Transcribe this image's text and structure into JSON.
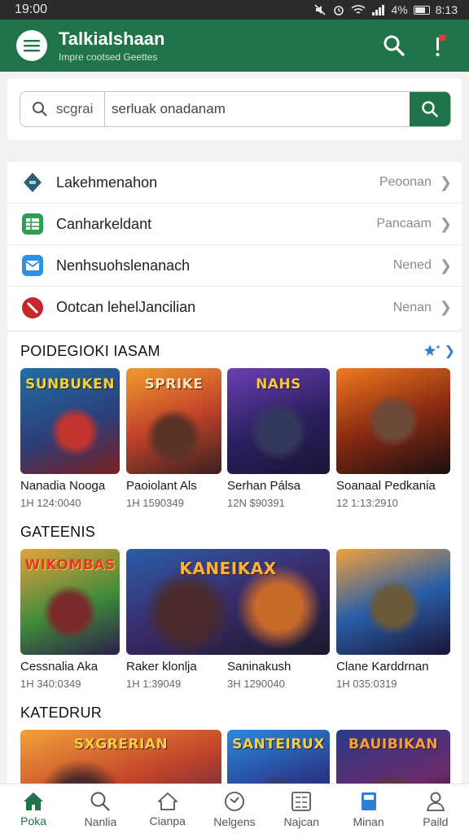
{
  "status_bar": {
    "time": "19:00",
    "battery_text": "4%",
    "clock_right": "8:13"
  },
  "app_bar": {
    "title": "Talkialshaan",
    "subtitle": "Impre cootsed Geettes"
  },
  "search": {
    "scope_label": "scgrai",
    "query": "serluak onadanam"
  },
  "list_items": [
    {
      "label": "Lakehmenahon",
      "value": "Peoonan",
      "icon": "tag-icon",
      "color": "#2f5d6e"
    },
    {
      "label": "Canharkeldant",
      "value": "Pancaam",
      "icon": "spreadsheet-icon",
      "color": "#2e9e55"
    },
    {
      "label": "Nenhsuohslenanach",
      "value": "Nened",
      "icon": "mail-icon",
      "color": "#2f8fe0"
    },
    {
      "label": "Ootcan lehelJancilian",
      "value": "Nenan",
      "icon": "slash-icon",
      "color": "#c8262b"
    }
  ],
  "sections": [
    {
      "title": "POIDEGIOKI IASAM",
      "more_icon": "sparkle-icon",
      "games": [
        {
          "art_title": "SUNBUKEN",
          "name": "Nanadia Nooga",
          "meta": "1H 124:0040"
        },
        {
          "art_title": "SPRIKE",
          "name": "Paoiolant Als",
          "meta": "1H 1590349"
        },
        {
          "art_title": "NAHS",
          "name": "Serhan Pálsa",
          "meta": "12N $90391"
        },
        {
          "art_title": "",
          "name": "Soanaal Pedkania",
          "meta": "12 1:13:2910"
        }
      ]
    },
    {
      "title": "GATEENIS",
      "games": [
        {
          "art_title": "WIKOMBAS",
          "name": "Cessnalia Aka",
          "meta": "1H 340:0349"
        },
        {
          "art_title": "KANEIKAX",
          "name": "Raker klonlja",
          "meta": "1H 1:39049"
        },
        {
          "art_title": "",
          "name": "Saninakush",
          "meta": "3H 1290040"
        },
        {
          "art_title": "",
          "name": "Clane Karddrnan",
          "meta": "1H 035:0319"
        }
      ]
    },
    {
      "title": "KATEDRUR",
      "games": [
        {
          "art_title": "SXGRERIAN"
        },
        {
          "art_title": "SANTEIRUX"
        },
        {
          "art_title": "BAUIBIKAN"
        }
      ]
    }
  ],
  "bottom_nav": [
    {
      "label": "Poka",
      "icon": "home-icon",
      "active": true
    },
    {
      "label": "Nanlia",
      "icon": "search-icon"
    },
    {
      "label": "Cianpa",
      "icon": "house-outline-icon"
    },
    {
      "label": "Nelgens",
      "icon": "clock-icon"
    },
    {
      "label": "Najcan",
      "icon": "grid-icon"
    },
    {
      "label": "Minan",
      "icon": "document-icon"
    },
    {
      "label": "Paild",
      "icon": "profile-icon"
    }
  ],
  "colors": {
    "primary": "#20744a",
    "accent_blue": "#2f7fd4"
  }
}
